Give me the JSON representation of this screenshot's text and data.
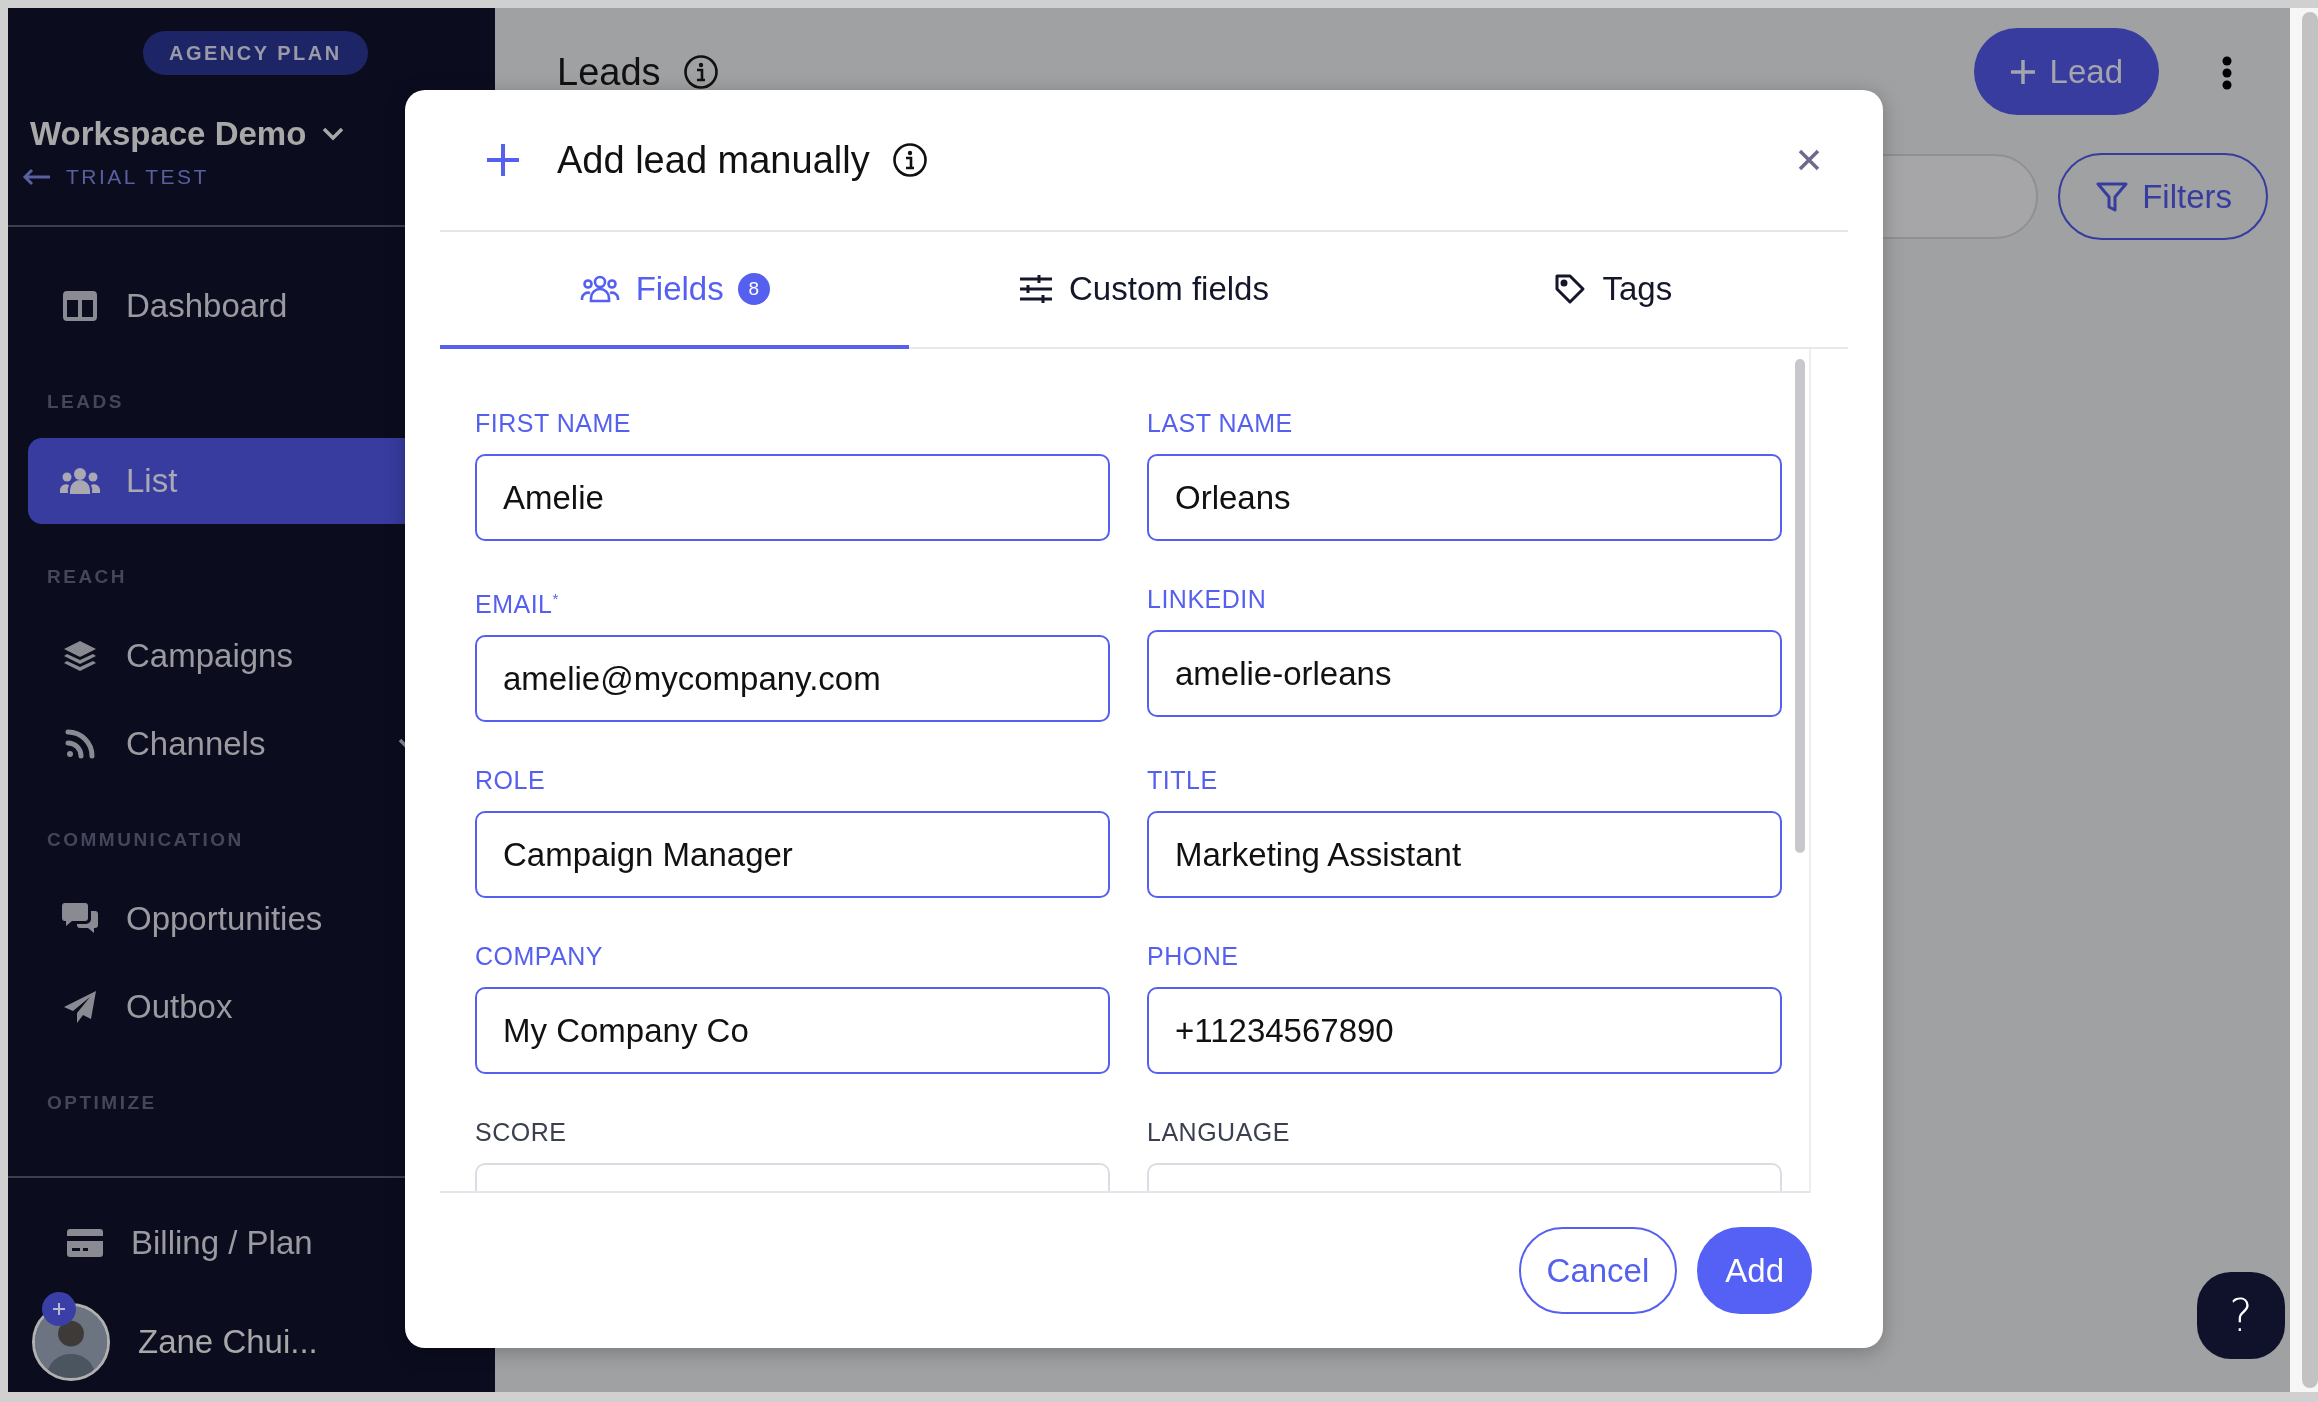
{
  "sidebar": {
    "plan_badge": "AGENCY PLAN",
    "workspace": "Workspace Demo",
    "back_link": "TRIAL TEST",
    "sections": [
      {
        "items": [
          {
            "label": "Dashboard",
            "kind": "dashboard",
            "selected": false,
            "expandable": false
          }
        ]
      },
      {
        "heading": "LEADS",
        "items": [
          {
            "label": "List",
            "kind": "users",
            "selected": true,
            "expandable": false
          }
        ]
      },
      {
        "heading": "REACH",
        "items": [
          {
            "label": "Campaigns",
            "kind": "layers",
            "selected": false,
            "expandable": false
          },
          {
            "label": "Channels",
            "kind": "rss",
            "selected": false,
            "expandable": true
          }
        ]
      },
      {
        "heading": "COMMUNICATION",
        "items": [
          {
            "label": "Opportunities",
            "kind": "chat",
            "selected": false,
            "expandable": false
          },
          {
            "label": "Outbox",
            "kind": "send",
            "selected": false,
            "expandable": false
          }
        ]
      },
      {
        "heading": "OPTIMIZE"
      }
    ],
    "footer_items": [
      {
        "label": "Billing / Plan",
        "kind": "card",
        "selected": false
      }
    ],
    "user": {
      "name": "Zane Chui..."
    }
  },
  "page": {
    "title": "Leads",
    "add_button": "Lead",
    "filters_button": "Filters",
    "help_button": "?"
  },
  "modal": {
    "title": "Add lead manually",
    "tabs": [
      {
        "label": "Fields",
        "kind": "users",
        "badge": "8",
        "selected": true
      },
      {
        "label": "Custom fields",
        "kind": "sliders",
        "selected": false
      },
      {
        "label": "Tags",
        "kind": "tag",
        "selected": false
      }
    ],
    "fields": [
      {
        "label": "FIRST NAME",
        "value": "Amelie",
        "filled": true
      },
      {
        "label": "LAST NAME",
        "value": "Orleans",
        "filled": true
      },
      {
        "label": "EMAIL$^{*}$",
        "value": "amelie@mycompany.com",
        "filled": true
      },
      {
        "label": "LINKEDIN",
        "value": "amelie-orleans",
        "filled": true
      },
      {
        "label": "ROLE",
        "value": "Campaign Manager",
        "filled": true
      },
      {
        "label": "TITLE",
        "value": "Marketing Assistant",
        "filled": true
      },
      {
        "label": "COMPANY",
        "value": "My Company Co",
        "filled": true
      },
      {
        "label": "PHONE",
        "value": "+11234567890",
        "filled": true
      },
      {
        "label": "SCORE",
        "filled": false
      },
      {
        "label": "LANGUAGE",
        "filled": false
      }
    ],
    "cancel_button": "Cancel",
    "add_button": "Add"
  }
}
